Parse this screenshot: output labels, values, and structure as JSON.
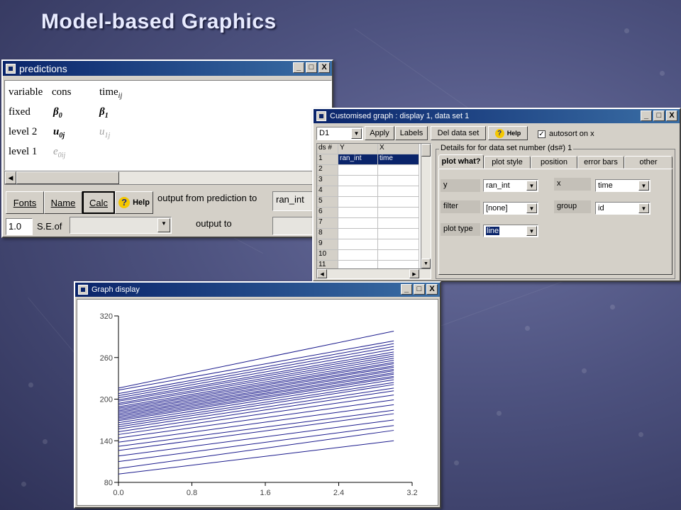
{
  "slide_title": "Model-based Graphics",
  "predictions": {
    "title": "predictions",
    "titlebar_buttons": [
      "_",
      "□",
      "X"
    ],
    "table": {
      "header": {
        "variable": "variable",
        "cons": "cons",
        "time": "time",
        "time_sub": "ij"
      },
      "rows": [
        {
          "label": "fixed",
          "c1": "β",
          "c1_sub": "0",
          "c2": "β",
          "c2_sub": "1"
        },
        {
          "label": "level  2",
          "c1": "u",
          "c1_sub": "0j",
          "c2": "u",
          "c2_sub": "1j"
        },
        {
          "label": "level  1",
          "c1": "e",
          "c1_sub": "0ij"
        }
      ]
    },
    "buttons": {
      "fonts": "Fonts",
      "name": "Name",
      "calc": "Calc",
      "help": "Help"
    },
    "output_from_label": "output from prediction to",
    "output_from_value": "ran_int",
    "output_to_label": "output to",
    "multiplier": "1.0",
    "se_of": "S.E.of"
  },
  "custom_graph": {
    "title": "Customised graph : display  1, data set 1",
    "titlebar_buttons": [
      "_",
      "□",
      "X"
    ],
    "display_select": "D1",
    "buttons": {
      "apply": "Apply",
      "labels": "Labels",
      "del": "Del data set",
      "help": "Help"
    },
    "autosort_label": "autosort on x",
    "autosort_checked": true,
    "grid": {
      "headers": [
        "ds #",
        "Y",
        "X"
      ],
      "rows": [
        [
          "1",
          "ran_int",
          "time"
        ],
        [
          "2",
          "",
          ""
        ],
        [
          "3",
          "",
          ""
        ],
        [
          "4",
          "",
          ""
        ],
        [
          "5",
          "",
          ""
        ],
        [
          "6",
          "",
          ""
        ],
        [
          "7",
          "",
          ""
        ],
        [
          "8",
          "",
          ""
        ],
        [
          "9",
          "",
          ""
        ],
        [
          "10",
          "",
          ""
        ],
        [
          "11",
          "",
          ""
        ]
      ]
    },
    "details_label": "Details for for data set number (ds#) 1",
    "tabs": [
      "plot what?",
      "plot style",
      "position",
      "error bars",
      "other"
    ],
    "fields": {
      "y_label": "y",
      "y_value": "ran_int",
      "x_label": "x",
      "x_value": "time",
      "filter_label": "filter",
      "filter_value": "[none]",
      "group_label": "group",
      "group_value": "id",
      "plot_type_label": "plot type",
      "plot_type_value": "line"
    }
  },
  "graph_display": {
    "title": "Graph display",
    "titlebar_buttons": [
      "_",
      "□",
      "X"
    ]
  },
  "chart_data": {
    "type": "line",
    "xlim": [
      0,
      3.2
    ],
    "ylim": [
      80,
      320
    ],
    "xticks": [
      "0.0",
      "0.8",
      "1.6",
      "2.4",
      "3.2"
    ],
    "yticks": [
      "80",
      "140",
      "200",
      "260",
      "320"
    ],
    "x": [
      0,
      3
    ],
    "line_color": "#1a1a8c",
    "series": [
      {
        "values": [
          216,
          298
        ]
      },
      {
        "values": [
          213,
          284
        ]
      },
      {
        "values": [
          208,
          280
        ]
      },
      {
        "values": [
          205,
          276
        ]
      },
      {
        "values": [
          202,
          272
        ]
      },
      {
        "values": [
          199,
          268
        ]
      },
      {
        "values": [
          197,
          265
        ]
      },
      {
        "values": [
          194,
          262
        ]
      },
      {
        "values": [
          192,
          259
        ]
      },
      {
        "values": [
          189,
          256
        ]
      },
      {
        "values": [
          187,
          253
        ]
      },
      {
        "values": [
          185,
          251
        ]
      },
      {
        "values": [
          183,
          248
        ]
      },
      {
        "values": [
          181,
          246
        ]
      },
      {
        "values": [
          179,
          243
        ]
      },
      {
        "values": [
          177,
          241
        ]
      },
      {
        "values": [
          175,
          238
        ]
      },
      {
        "values": [
          173,
          236
        ]
      },
      {
        "values": [
          171,
          233
        ]
      },
      {
        "values": [
          169,
          231
        ]
      },
      {
        "values": [
          166,
          228
        ]
      },
      {
        "values": [
          163,
          224
        ]
      },
      {
        "values": [
          160,
          221
        ]
      },
      {
        "values": [
          157,
          216
        ]
      },
      {
        "values": [
          153,
          212
        ]
      },
      {
        "values": [
          149,
          206
        ]
      },
      {
        "values": [
          144,
          199
        ]
      },
      {
        "values": [
          138,
          192
        ]
      },
      {
        "values": [
          132,
          184
        ]
      },
      {
        "values": [
          126,
          179
        ]
      },
      {
        "values": [
          118,
          170
        ]
      },
      {
        "values": [
          110,
          162
        ]
      },
      {
        "values": [
          100,
          155
        ]
      },
      {
        "values": [
          92,
          140
        ]
      }
    ]
  }
}
